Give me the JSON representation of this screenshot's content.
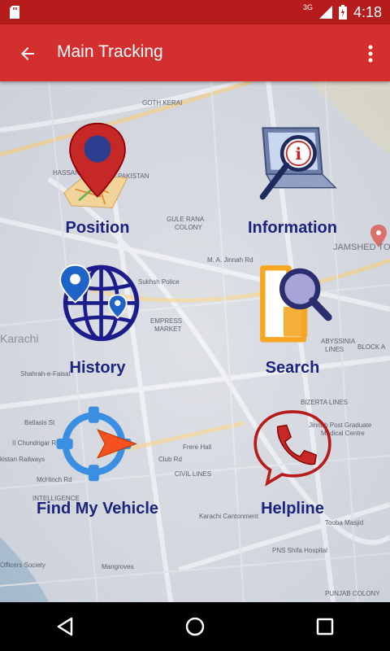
{
  "status_bar": {
    "time": "4:18",
    "network": "3G"
  },
  "app_bar": {
    "title": "Main Tracking"
  },
  "menu": [
    {
      "id": "position",
      "label": "Position"
    },
    {
      "id": "information",
      "label": "Information"
    },
    {
      "id": "history",
      "label": "History"
    },
    {
      "id": "search",
      "label": "Search"
    },
    {
      "id": "find",
      "label": "Find My Vehicle"
    },
    {
      "id": "helpline",
      "label": "Helpline"
    }
  ],
  "map_labels": {
    "goth": "GOTH KERAI",
    "hassan": "HASSAN",
    "pakistan": "PAKISTAN",
    "gule": "GULE RANA",
    "gule2": "COLONY",
    "jinnah": "M. A. Jinnah Rd",
    "karachi": "Karachi",
    "empress": "EMPRESS",
    "empress2": "MARKET",
    "sukhsh": "Sukhsh Police",
    "jamshed": "JAMSHED TOW",
    "abyssinia": "ABYSSINIA",
    "lines": "LINES",
    "block": "BLOCK A",
    "bizerta": "BIZERTA LINES",
    "shahrah": "Shahrah-e-Faisal",
    "bellasis": "Bellasis St",
    "chundrigar": "II Chundrigar Rd",
    "railway": "kistan Railways",
    "mcinch": "McHinch Rd",
    "club": "Club Rd",
    "frere": "Frere Hall",
    "civil": "CIVIL LINES",
    "cantonment": "Karachi Cantonment",
    "toobe": "Tooba Masjid",
    "pns": "PNS Shifa Hospital",
    "officers": "Officers Society",
    "mangroves": "Mangroves",
    "punjab": "PUNJAB COLONY",
    "intelligence": "INTELLIGENCE",
    "jinnah_post": "Jinnah Post Graduate",
    "medical": "Medical Centre"
  },
  "colors": {
    "primary": "#d32f2f",
    "primary_dark": "#b71c1c",
    "label": "#1a237e"
  }
}
